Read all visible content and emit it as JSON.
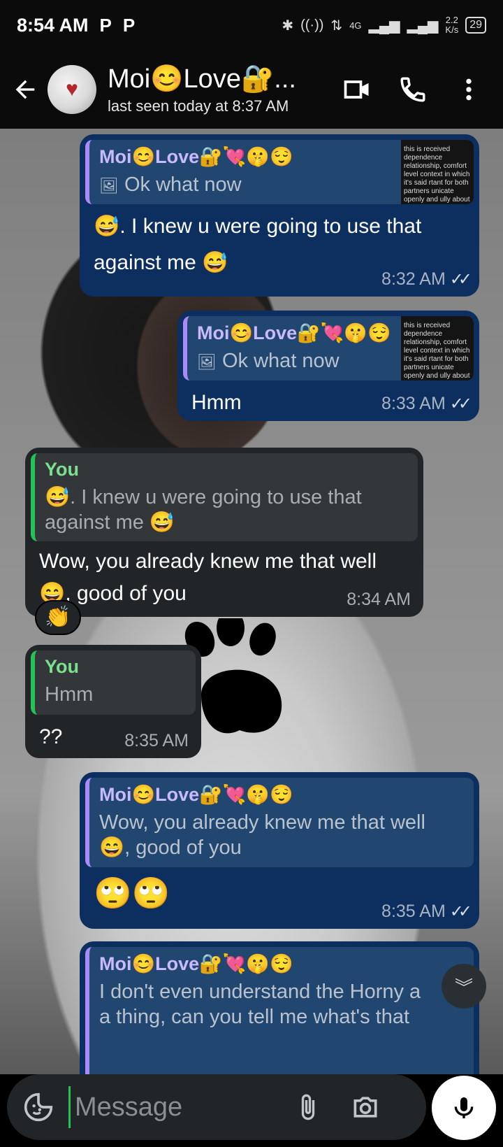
{
  "status_bar": {
    "time": "8:54 AM",
    "notif_1": "P",
    "notif_2": "P",
    "network": "4G",
    "net_speed_value": "2.2",
    "net_speed_unit": "K/s",
    "battery": "29"
  },
  "header": {
    "contact_name": "Moi😊Love🔐...",
    "last_seen": "last seen today at 8:37 AM"
  },
  "messages": [
    {
      "quote_name": "Moi😊Love🔐💘🤫😌",
      "quote_text": "Ok what now",
      "quote_thumb": "this is received dependence relationship, comfort level context in which it's said rtant for both partners unicate openly and ully about boundaries a",
      "text_1": "😅. I knew u were going to use that",
      "text_2": "against me 😅",
      "time": "8:32 AM"
    },
    {
      "quote_name": "Moi😊Love🔐💘🤫😌",
      "quote_text": "Ok what now",
      "quote_thumb": "this is received dependence relationship, comfort level context in which it's said rtant for both partners unicate openly and ully about boundaries a",
      "text": "Hmm",
      "time": "8:33 AM"
    },
    {
      "quote_name": "You",
      "quote_text_1": "😅. I knew u were going to use that",
      "quote_text_2": "against me 😅",
      "text_1": "Wow, you already knew me that well",
      "text_2": "😄, good of you",
      "time": "8:34 AM",
      "reaction": "👏"
    },
    {
      "quote_name": "You",
      "quote_text": "Hmm",
      "text": "??",
      "time": "8:35 AM"
    },
    {
      "quote_name": "Moi😊Love🔐💘🤫😌",
      "quote_text_1": "Wow, you already knew me that well",
      "quote_text_2": "😄, good of you",
      "text": "🙄🙄",
      "time": "8:35 AM"
    },
    {
      "quote_name": "Moi😊Love🔐💘🤫😌",
      "quote_text_1": "I don't even understand the Horny a",
      "quote_text_2": "a thing, can you tell me what's that"
    }
  ],
  "composer": {
    "placeholder": "Message"
  }
}
